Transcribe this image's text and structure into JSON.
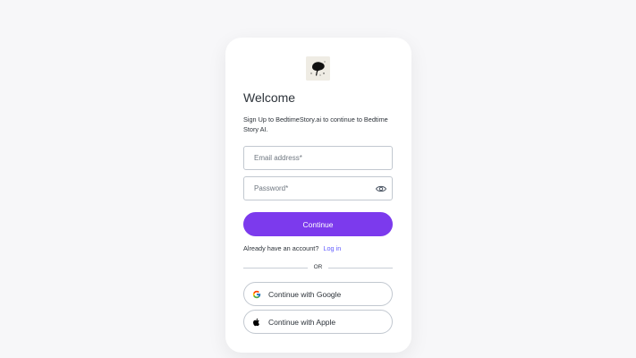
{
  "header": {
    "logo_icon": "story-logo-icon",
    "title": "Welcome",
    "subtitle": "Sign Up to BedtimeStory.ai to continue to Bedtime Story AI."
  },
  "form": {
    "email_placeholder": "Email address*",
    "email_value": "",
    "password_placeholder": "Password*",
    "password_value": "",
    "password_toggle_icon": "eye-icon",
    "continue_label": "Continue"
  },
  "login": {
    "prompt": "Already have an account?",
    "link_label": "Log in"
  },
  "divider": {
    "label": "OR"
  },
  "social": {
    "google_label": "Continue with Google",
    "google_icon": "google-icon",
    "apple_label": "Continue with Apple",
    "apple_icon": "apple-icon"
  },
  "colors": {
    "accent": "#7c3aed",
    "link": "#635dff",
    "background": "#f7f7f9",
    "card": "#ffffff"
  }
}
